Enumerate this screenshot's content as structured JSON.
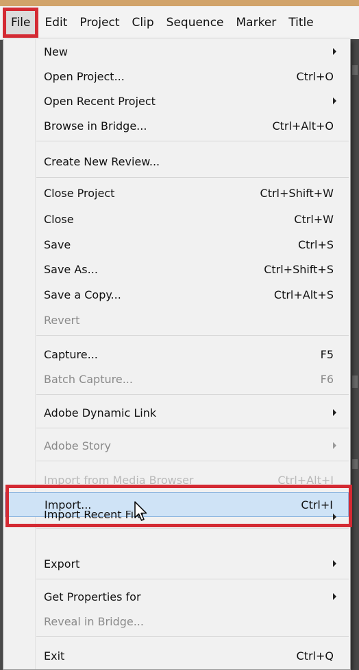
{
  "menubar": {
    "items": [
      "File",
      "Edit",
      "Project",
      "Clip",
      "Sequence",
      "Marker",
      "Title"
    ]
  },
  "file_menu": {
    "items": [
      {
        "label": "New",
        "shortcut": "",
        "submenu": true,
        "enabled": true
      },
      {
        "label": "Open Project...",
        "shortcut": "Ctrl+O",
        "submenu": false,
        "enabled": true
      },
      {
        "label": "Open Recent Project",
        "shortcut": "",
        "submenu": true,
        "enabled": true
      },
      {
        "label": "Browse in Bridge...",
        "shortcut": "Ctrl+Alt+O",
        "submenu": false,
        "enabled": true
      },
      {
        "label": "Create New Review...",
        "shortcut": "",
        "submenu": false,
        "enabled": true
      },
      {
        "label": "Close Project",
        "shortcut": "Ctrl+Shift+W",
        "submenu": false,
        "enabled": true
      },
      {
        "label": "Close",
        "shortcut": "Ctrl+W",
        "submenu": false,
        "enabled": true
      },
      {
        "label": "Save",
        "shortcut": "Ctrl+S",
        "submenu": false,
        "enabled": true
      },
      {
        "label": "Save As...",
        "shortcut": "Ctrl+Shift+S",
        "submenu": false,
        "enabled": true
      },
      {
        "label": "Save a Copy...",
        "shortcut": "Ctrl+Alt+S",
        "submenu": false,
        "enabled": true
      },
      {
        "label": "Revert",
        "shortcut": "",
        "submenu": false,
        "enabled": false
      },
      {
        "label": "Capture...",
        "shortcut": "F5",
        "submenu": false,
        "enabled": true
      },
      {
        "label": "Batch Capture...",
        "shortcut": "F6",
        "submenu": false,
        "enabled": false
      },
      {
        "label": "Adobe Dynamic Link",
        "shortcut": "",
        "submenu": true,
        "enabled": true
      },
      {
        "label": "Adobe Story",
        "shortcut": "",
        "submenu": true,
        "enabled": false
      },
      {
        "label": "Import from Media Browser",
        "shortcut": "Ctrl+Alt+I",
        "submenu": false,
        "enabled": false
      },
      {
        "label": "Import...",
        "shortcut": "Ctrl+I",
        "submenu": false,
        "enabled": true,
        "highlighted": true
      },
      {
        "label": "Import Recent File",
        "shortcut": "",
        "submenu": true,
        "enabled": true
      },
      {
        "label": "Export",
        "shortcut": "",
        "submenu": true,
        "enabled": true
      },
      {
        "label": "Get Properties for",
        "shortcut": "",
        "submenu": true,
        "enabled": true
      },
      {
        "label": "Reveal in Bridge...",
        "shortcut": "",
        "submenu": false,
        "enabled": false
      },
      {
        "label": "Exit",
        "shortcut": "Ctrl+Q",
        "submenu": false,
        "enabled": true
      }
    ]
  },
  "colors": {
    "highlight_box": "#d42a33",
    "selection_fill": "#cfe3f6",
    "menu_background": "#f1f1f1"
  }
}
